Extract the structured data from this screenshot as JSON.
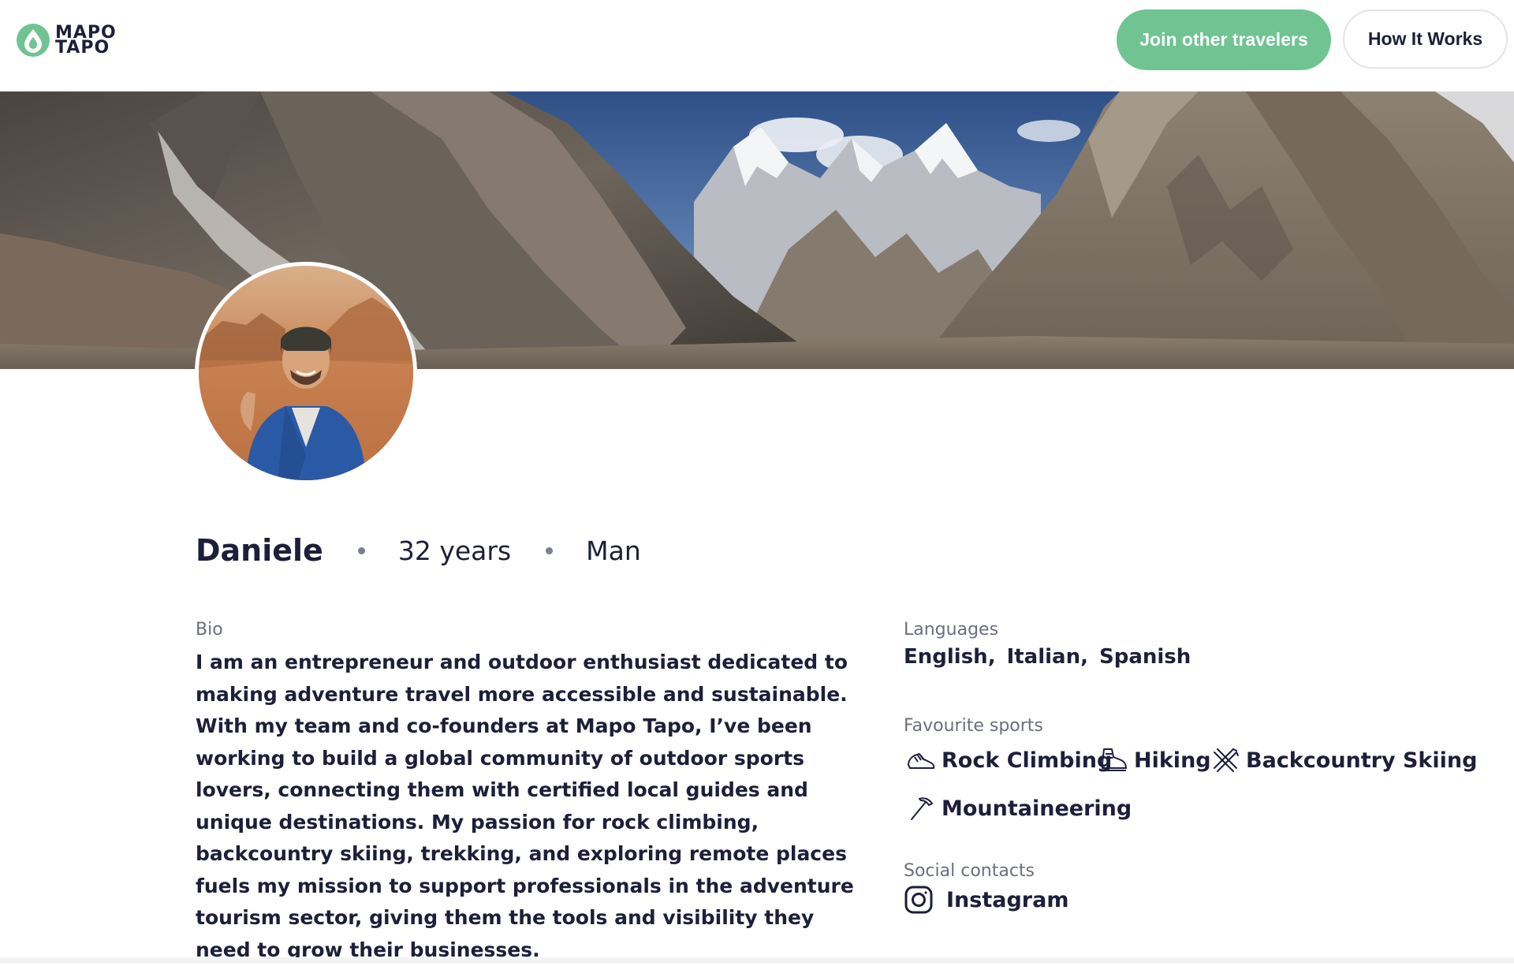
{
  "brand": {
    "logo_line1": "MAPO",
    "logo_line2": "TAPO",
    "accent_color": "#6fc492"
  },
  "header": {
    "join_label": "Join other travelers",
    "how_label": "How It Works"
  },
  "profile": {
    "name": "Daniele",
    "age": "32 years",
    "gender": "Man"
  },
  "bio": {
    "label": "Bio",
    "text": "I am an entrepreneur and outdoor enthusiast dedicated to making adventure travel more accessible and sustainable. With my team and co-founders at Mapo Tapo, I’ve been working to build a global community of outdoor sports lovers, connecting them with certified local guides and unique destinations. My passion for rock climbing, backcountry skiing, trekking, and exploring remote places fuels my mission to support professionals in the adventure tourism sector, giving them the tools and visibility they need to grow their businesses."
  },
  "languages": {
    "label": "Languages",
    "items": [
      "English,",
      "Italian,",
      "Spanish"
    ]
  },
  "sports": {
    "label": "Favourite sports",
    "items": [
      {
        "label": "Rock Climbing",
        "icon": "climbing-shoe-icon"
      },
      {
        "label": "Hiking",
        "icon": "hiking-boot-icon"
      },
      {
        "label": "Backcountry Skiing",
        "icon": "skis-icon"
      },
      {
        "label": "Mountaineering",
        "icon": "ice-axe-icon"
      }
    ]
  },
  "social": {
    "label": "Social contacts",
    "instagram": "Instagram"
  }
}
